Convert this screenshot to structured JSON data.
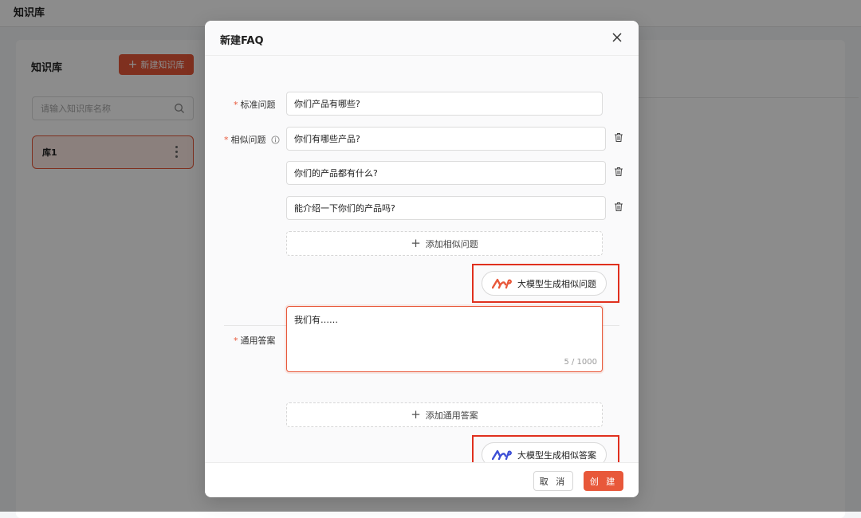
{
  "app": {
    "header_title": "知识库",
    "sidebar_title": "知识库",
    "new_kb_label": "新建知识库",
    "search_placeholder": "请输入知识库名称",
    "kb_items": [
      {
        "name": "库1"
      }
    ]
  },
  "modal": {
    "title": "新建FAQ",
    "fields": {
      "standard_question": {
        "label": "标准问题",
        "value": "你们产品有哪些?"
      },
      "similar_questions": {
        "label": "相似问题",
        "items": [
          "你们有哪些产品?",
          "你们的产品都有什么?",
          "能介绍一下你们的产品吗?"
        ]
      },
      "add_similar_label": "添加相似问题",
      "ai_similar_label": "大模型生成相似问题",
      "answer": {
        "label": "通用答案",
        "value": "我们有……",
        "counter": "5 / 1000"
      },
      "add_answer_label": "添加通用答案",
      "ai_answer_label": "大模型生成相似答案"
    },
    "footer": {
      "cancel_label": "取 消",
      "create_label": "创 建"
    }
  },
  "colors": {
    "accent": "#e8583a",
    "highlight": "#e0301e",
    "ai_blue": "#3d4fd6"
  },
  "icons": [
    "close-icon",
    "plus-icon",
    "search-icon",
    "info-icon",
    "trash-icon",
    "ai-logo-icon",
    "more-vertical-icon"
  ]
}
